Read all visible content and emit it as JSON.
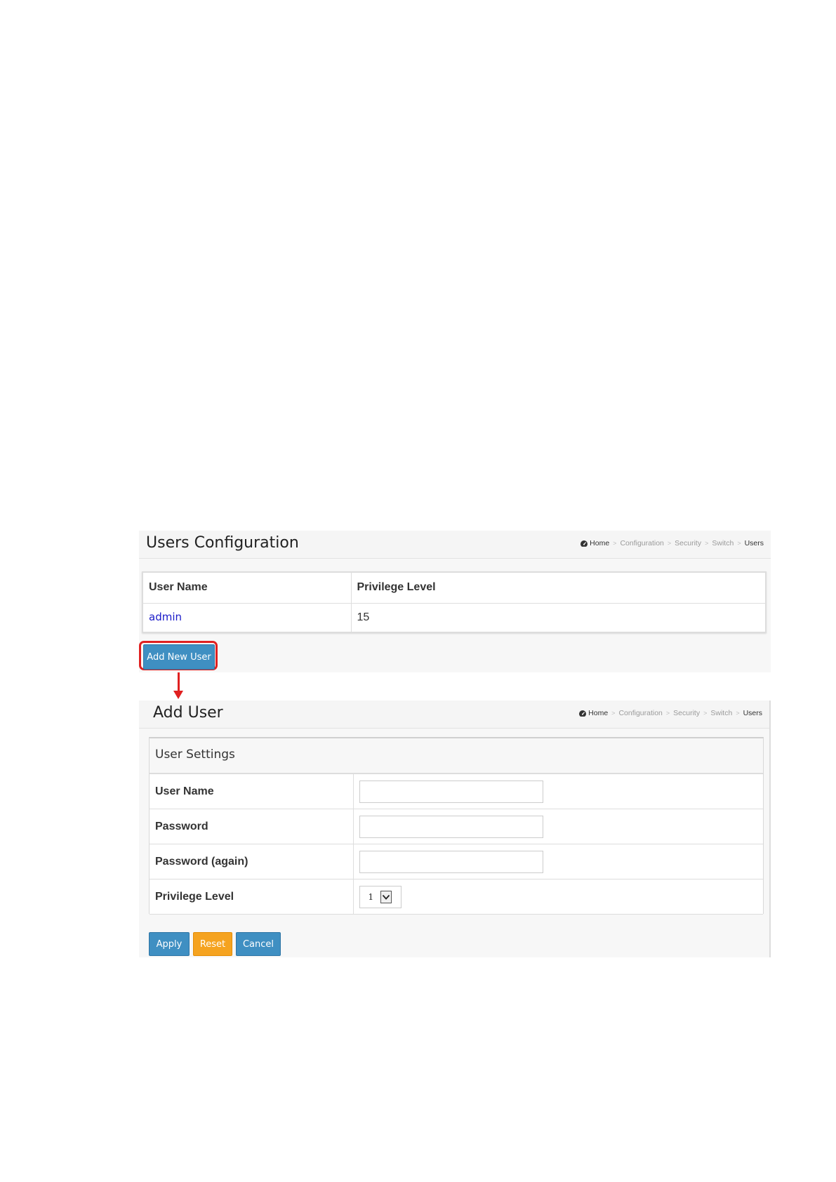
{
  "users_config": {
    "title": "Users Configuration",
    "breadcrumb": [
      "Home",
      "Configuration",
      "Security",
      "Switch",
      "Users"
    ],
    "table": {
      "headers": [
        "User Name",
        "Privilege Level"
      ],
      "rows": [
        {
          "user_name": "admin",
          "privilege_level": "15"
        }
      ]
    },
    "add_button_label": "Add New User"
  },
  "add_user": {
    "title": "Add User",
    "breadcrumb": [
      "Home",
      "Configuration",
      "Security",
      "Switch",
      "Users"
    ],
    "section_title": "User Settings",
    "fields": {
      "user_name": {
        "label": "User Name",
        "value": ""
      },
      "password": {
        "label": "Password",
        "value": ""
      },
      "password_again": {
        "label": "Password (again)",
        "value": ""
      },
      "privilege_level": {
        "label": "Privilege Level",
        "value": "1"
      }
    },
    "buttons": {
      "apply": "Apply",
      "reset": "Reset",
      "cancel": "Cancel"
    }
  },
  "colors": {
    "primary_button": "#3f8fc2",
    "warning_button": "#f5a320",
    "highlight": "#e02020",
    "link": "#1a1ac9"
  },
  "icons": {
    "home": "tachometer-icon",
    "select_arrow": "chevron-down-icon"
  }
}
